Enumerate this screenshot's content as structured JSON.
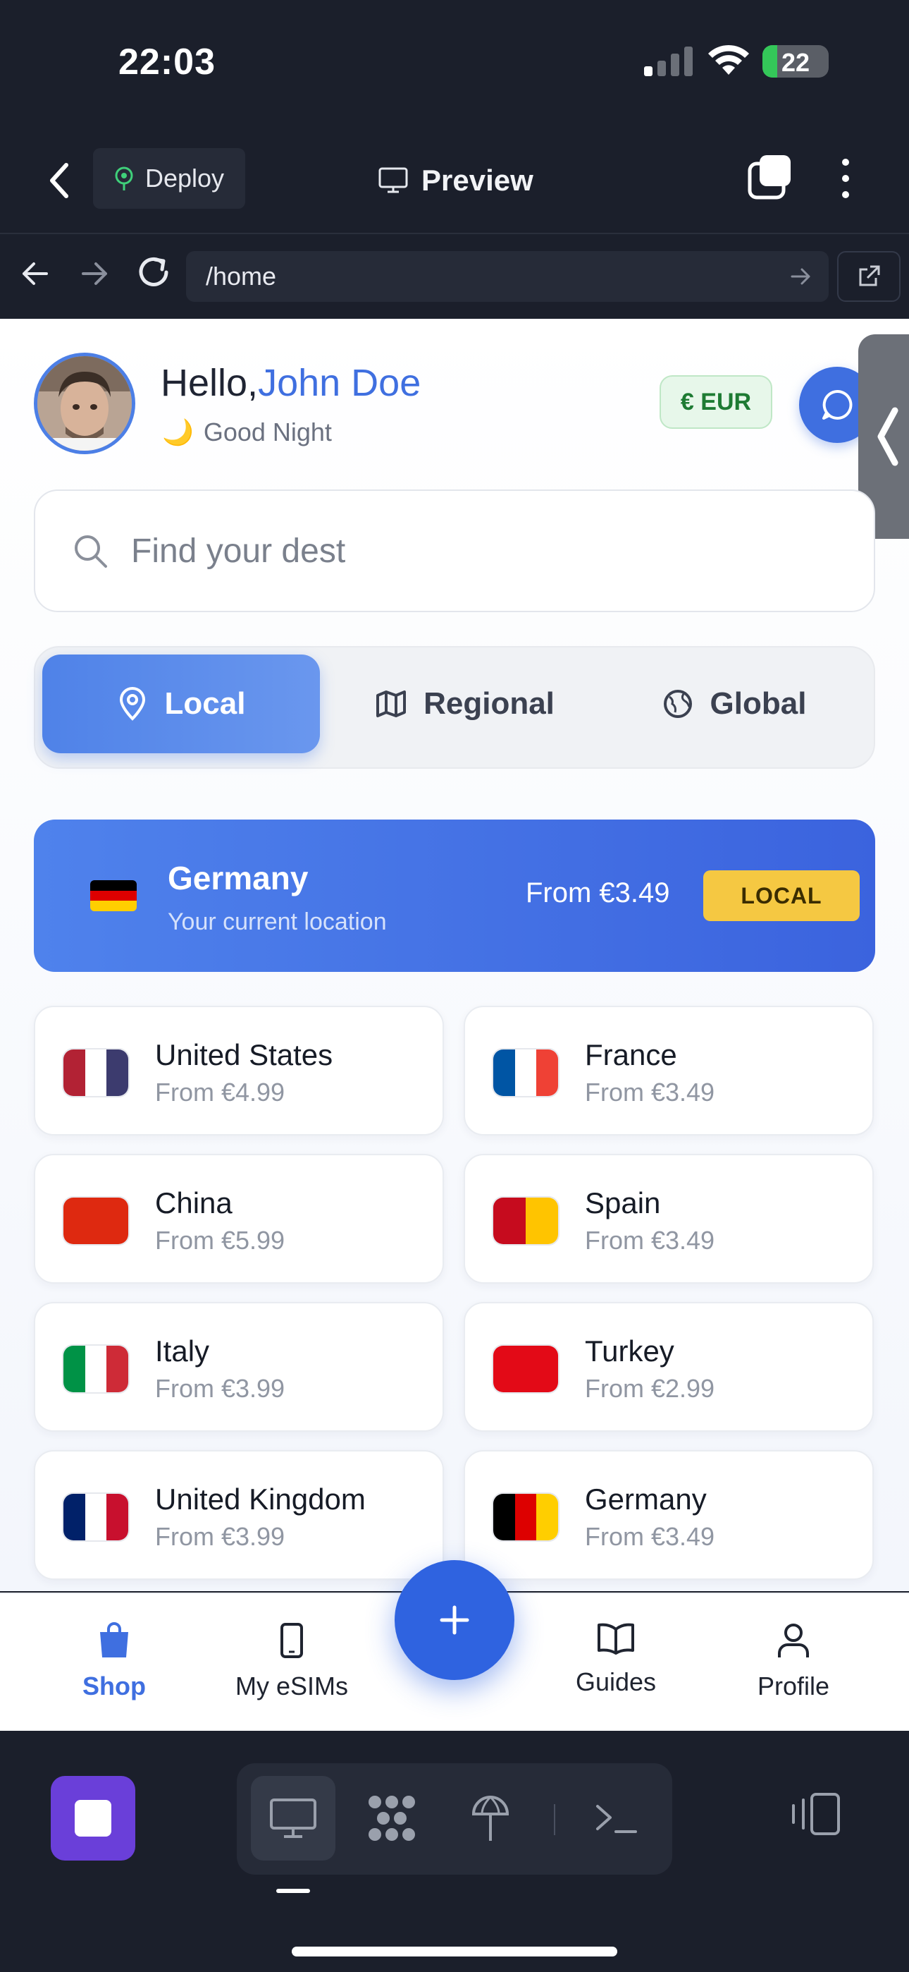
{
  "status_bar": {
    "time": "22:03",
    "battery": "22",
    "battery_level": 0.22
  },
  "toolbar": {
    "deploy_label": "Deploy",
    "preview_label": "Preview"
  },
  "browser": {
    "url": "/home"
  },
  "header": {
    "greeting": "Hello,",
    "user_name": "John Doe",
    "sub_greeting": "Good Night",
    "sub_greeting_emoji": "🌙",
    "currency": "€ EUR"
  },
  "search": {
    "placeholder": "Find your dest"
  },
  "segments": [
    {
      "label": "Local",
      "icon": "map-pin-icon",
      "active": true
    },
    {
      "label": "Regional",
      "icon": "map-icon",
      "active": false
    },
    {
      "label": "Global",
      "icon": "globe-icon",
      "active": false
    }
  ],
  "current_location": {
    "country": "Germany",
    "subtitle": "Your current location",
    "price": "From €3.49",
    "badge": "LOCAL"
  },
  "destinations": [
    {
      "name": "United States",
      "price": "From €4.99",
      "flag": [
        "#b22234",
        "#ffffff",
        "#3c3b6e"
      ]
    },
    {
      "name": "France",
      "price": "From €3.49",
      "flag": [
        "#0055a4",
        "#ffffff",
        "#ef4135"
      ]
    },
    {
      "name": "China",
      "price": "From €5.99",
      "flag": [
        "#de2910"
      ]
    },
    {
      "name": "Spain",
      "price": "From €3.49",
      "flag": [
        "#c60b1e",
        "#ffc400"
      ]
    },
    {
      "name": "Italy",
      "price": "From €3.99",
      "flag": [
        "#009246",
        "#ffffff",
        "#ce2b37"
      ]
    },
    {
      "name": "Turkey",
      "price": "From €2.99",
      "flag": [
        "#e30a17"
      ]
    },
    {
      "name": "United Kingdom",
      "price": "From €3.99",
      "flag": [
        "#012169",
        "#ffffff",
        "#c8102e"
      ]
    },
    {
      "name": "Germany",
      "price": "From €3.49",
      "flag": [
        "#000000",
        "#dd0000",
        "#ffce00"
      ]
    }
  ],
  "bottom_nav": {
    "shop": "Shop",
    "my_esims": "My eSIMs",
    "guides": "Guides",
    "profile": "Profile"
  },
  "colors": {
    "accent": "#3f6fe0",
    "badge": "#f5c842",
    "currency_bg": "#e7f7ea",
    "dock_app": "#6a3fd9"
  }
}
